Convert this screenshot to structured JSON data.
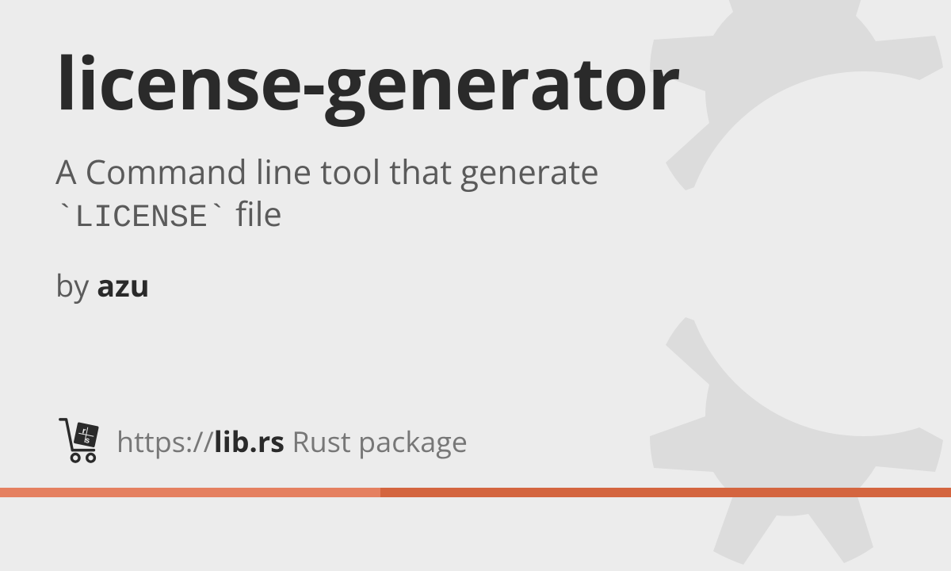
{
  "package": {
    "name": "license-generator",
    "description_prefix": "A Command line tool that generate ",
    "description_code": "`LICENSE`",
    "description_suffix": " file",
    "by_label": "by ",
    "author": "azu"
  },
  "footer": {
    "url_prefix": "https://",
    "url_domain": "lib.rs",
    "url_suffix": " Rust package"
  },
  "icons": {
    "logo": "librs-cart-icon",
    "background": "gear-icon"
  },
  "colors": {
    "accent_light": "#e58060",
    "accent_dark": "#d4653f",
    "bg": "#ececec"
  }
}
